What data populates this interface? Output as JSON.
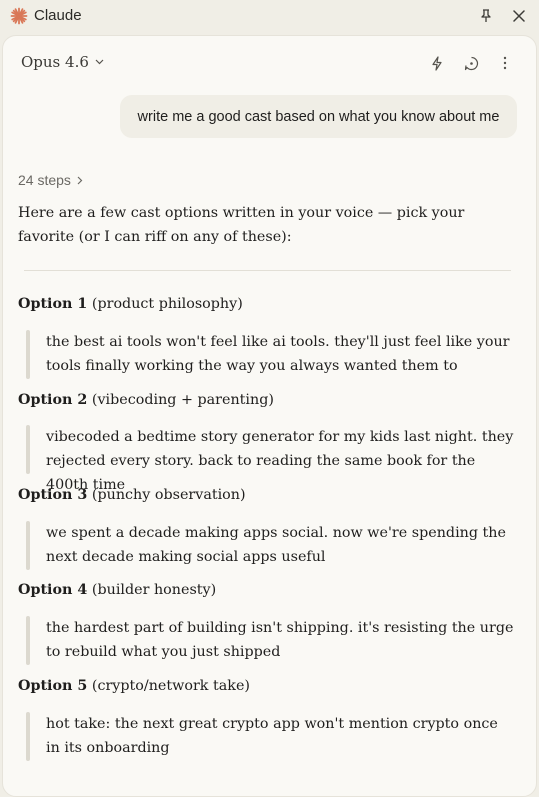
{
  "window": {
    "title": "Claude",
    "pin_icon": "pin-icon",
    "close_icon": "close-icon",
    "logo_icon": "claude-starburst-logo",
    "brand_color": "#d97757"
  },
  "header": {
    "model": "Opus 4.6",
    "icons": [
      "lightning-icon",
      "chat-refresh-icon",
      "more-vertical-icon"
    ]
  },
  "conversation": {
    "user_message": "write me a good cast based on what you know about me",
    "steps_label": "24 steps",
    "intro": "Here are a few cast options written in your voice — pick your favorite (or I can riff on any of these):",
    "options": [
      {
        "title": "Option 1",
        "subtitle": "(product philosophy)",
        "text": "the best ai tools won't feel like ai tools. they'll just feel like your tools finally working the way you always wanted them to"
      },
      {
        "title": "Option 2",
        "subtitle": "(vibecoding + parenting)",
        "text": "vibecoded a bedtime story generator for my kids last night. they rejected every story. back to reading the same book for the 400th time"
      },
      {
        "title": "Option 3",
        "subtitle": "(punchy observation)",
        "text": "we spent a decade making apps social. now we're spending the next decade making social apps useful"
      },
      {
        "title": "Option 4",
        "subtitle": "(builder honesty)",
        "text": "the hardest part of building isn't shipping. it's resisting the urge to rebuild what you just shipped"
      },
      {
        "title": "Option 5",
        "subtitle": "(crypto/network take)",
        "text": "hot take: the next great crypto app won't mention crypto once in its onboarding"
      }
    ]
  }
}
